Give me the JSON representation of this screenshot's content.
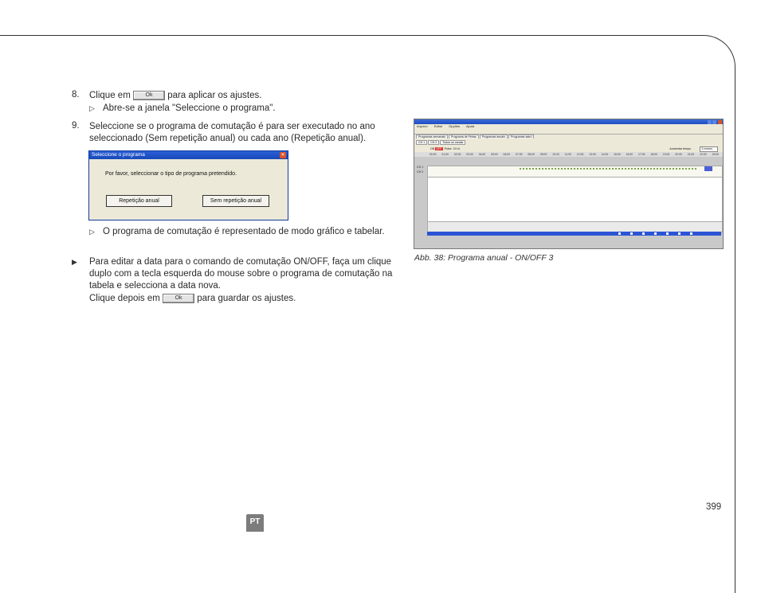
{
  "steps": [
    {
      "number": "8.",
      "before": "Clique em",
      "button": "Ok",
      "after": "para aplicar os ajustes."
    },
    {
      "number": "9.",
      "line1": "Seleccione se o programa de comutação é para ser executado no ano",
      "line2": "seleccionado (Sem repetição anual) ou cada ano (Repetição anual)."
    }
  ],
  "result_8": "Abre-se a janela \"Seleccione o programa\".",
  "dialog": {
    "title": "Seleccione o programa",
    "message": "Por favor, seleccionar o tipo de programa pretendido.",
    "btn_annual": "Repetição anual",
    "btn_no_repeat": "Sem repetição anual"
  },
  "result_9": "O programa de comutação é representado de modo gráfico e tabelar.",
  "bullet": {
    "line1": "Para editar a data para o comando de comutação ON/OFF, faça um clique",
    "line2": "duplo com a tecla esquerda do mouse sobre o programa de comutação na",
    "line3": "tabela e selecciona a data nova.",
    "line4_before": "Clique depois em",
    "line4_button": "Ok",
    "line4_after": "para guardar os ajustes."
  },
  "figure": {
    "menu": [
      "Arquivo",
      "Editar",
      "Opções",
      "Ajuda"
    ],
    "tabs": [
      "Programas semanais",
      "Programa de Férias",
      "Programas anuais",
      "Programas astro"
    ],
    "channel_tabs": [
      "CH 1",
      "CH 2",
      "Todos os canais"
    ],
    "toolbar": [
      "ON",
      "OFF",
      "Pulse",
      "CH-#"
    ],
    "zoom_label": "Aumentar tempo",
    "zoom_value": "3 meses",
    "hours": "00:00 01:00 02:00 03:00 04:00 05:00 06:00 07:00 08:00 09:00 10:00 11:00 12:00 13:00 14:00 15:00 16:00 17:00 18:00 19:00 20:00 21:00 22:00 23:00",
    "rows": [
      "CH 1",
      "CH 2"
    ],
    "caption": "Abb. 38:  Programa anual  - ON/OFF 3"
  },
  "footer": {
    "lang_badge": "PT",
    "page_number": "399"
  }
}
